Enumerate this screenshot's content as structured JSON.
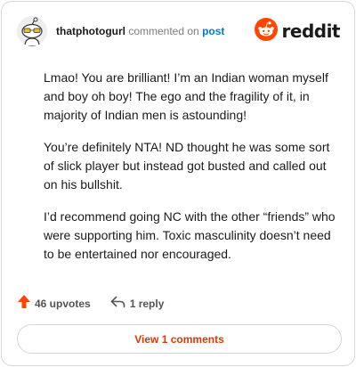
{
  "header": {
    "username": "thatphotogurl",
    "action": "commented on",
    "post_link": "post",
    "brand": "reddit"
  },
  "comment": {
    "paragraphs": [
      "Lmao! You are brilliant! I’m an Indian woman myself and boy oh boy! The ego and the fragility of it, in majority of Indian men is astounding!",
      "You’re definitely NTA! ND thought he was some sort of slick player but instead got busted and called out on his bullshit.",
      "I’d recommend going NC with the other “friends” who were supporting him. Toxic masculinity doesn’t need to be entertained nor encouraged."
    ]
  },
  "footer": {
    "upvotes_label": "46 upvotes",
    "reply_label": "1 reply",
    "view_button": "View 1 comments"
  },
  "colors": {
    "brand_orange": "#ff4500",
    "link_blue": "#0079d3",
    "button_text": "#d93a00"
  },
  "icons": {
    "avatar": "snoo-avatar-icon",
    "logo": "reddit-snoo-icon",
    "upvote": "upvote-arrow-icon",
    "reply": "reply-arrow-icon"
  }
}
